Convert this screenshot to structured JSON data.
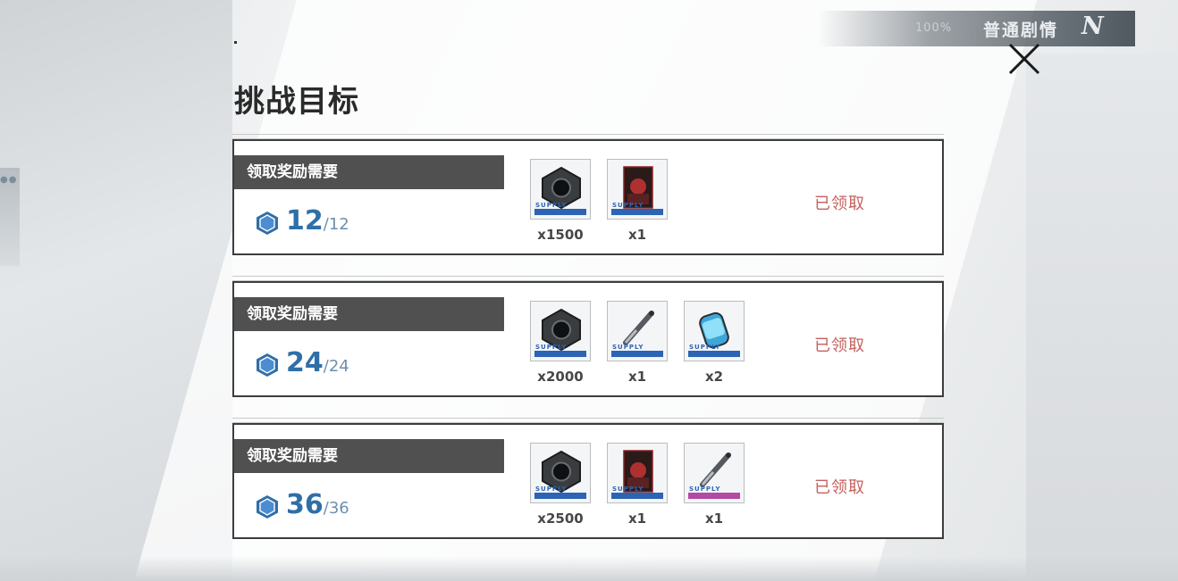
{
  "header": {
    "progress": "100%",
    "mode_label": "普通剧情",
    "mode_letter": "N"
  },
  "panel": {
    "title": "挑战目标"
  },
  "cards": [
    {
      "requirement_label": "领取奖励需要",
      "current": "12",
      "separator": "/",
      "required": "12",
      "rewards": [
        {
          "icon": "hex-nut-icon",
          "count": "x1500",
          "rarity_color": "#2c63b4"
        },
        {
          "icon": "card-01-icon",
          "card_number": "01",
          "count": "x1",
          "rarity_color": "#2c63b4"
        }
      ],
      "status": "已领取"
    },
    {
      "requirement_label": "领取奖励需要",
      "current": "24",
      "separator": "/",
      "required": "24",
      "rewards": [
        {
          "icon": "hex-nut-icon",
          "count": "x2000",
          "rarity_color": "#2c63b4"
        },
        {
          "icon": "syringe-icon",
          "count": "x1",
          "rarity_color": "#2c63b4"
        },
        {
          "icon": "canister-icon",
          "count": "x2",
          "rarity_color": "#2c63b4"
        }
      ],
      "status": "已领取"
    },
    {
      "requirement_label": "领取奖励需要",
      "current": "36",
      "separator": "/",
      "required": "36",
      "rewards": [
        {
          "icon": "hex-nut-icon",
          "count": "x2500",
          "rarity_color": "#2c63b4"
        },
        {
          "icon": "card-02-icon",
          "card_number": "02",
          "count": "x1",
          "rarity_color": "#2c63b4"
        },
        {
          "icon": "syringe-icon",
          "count": "x1",
          "rarity_color": "#b34aa3"
        }
      ],
      "status": "已领取"
    }
  ],
  "colors": {
    "progress_blue": "#2f6fa8",
    "claimed_red": "#c4615e",
    "requirement_bar": "#505050"
  }
}
